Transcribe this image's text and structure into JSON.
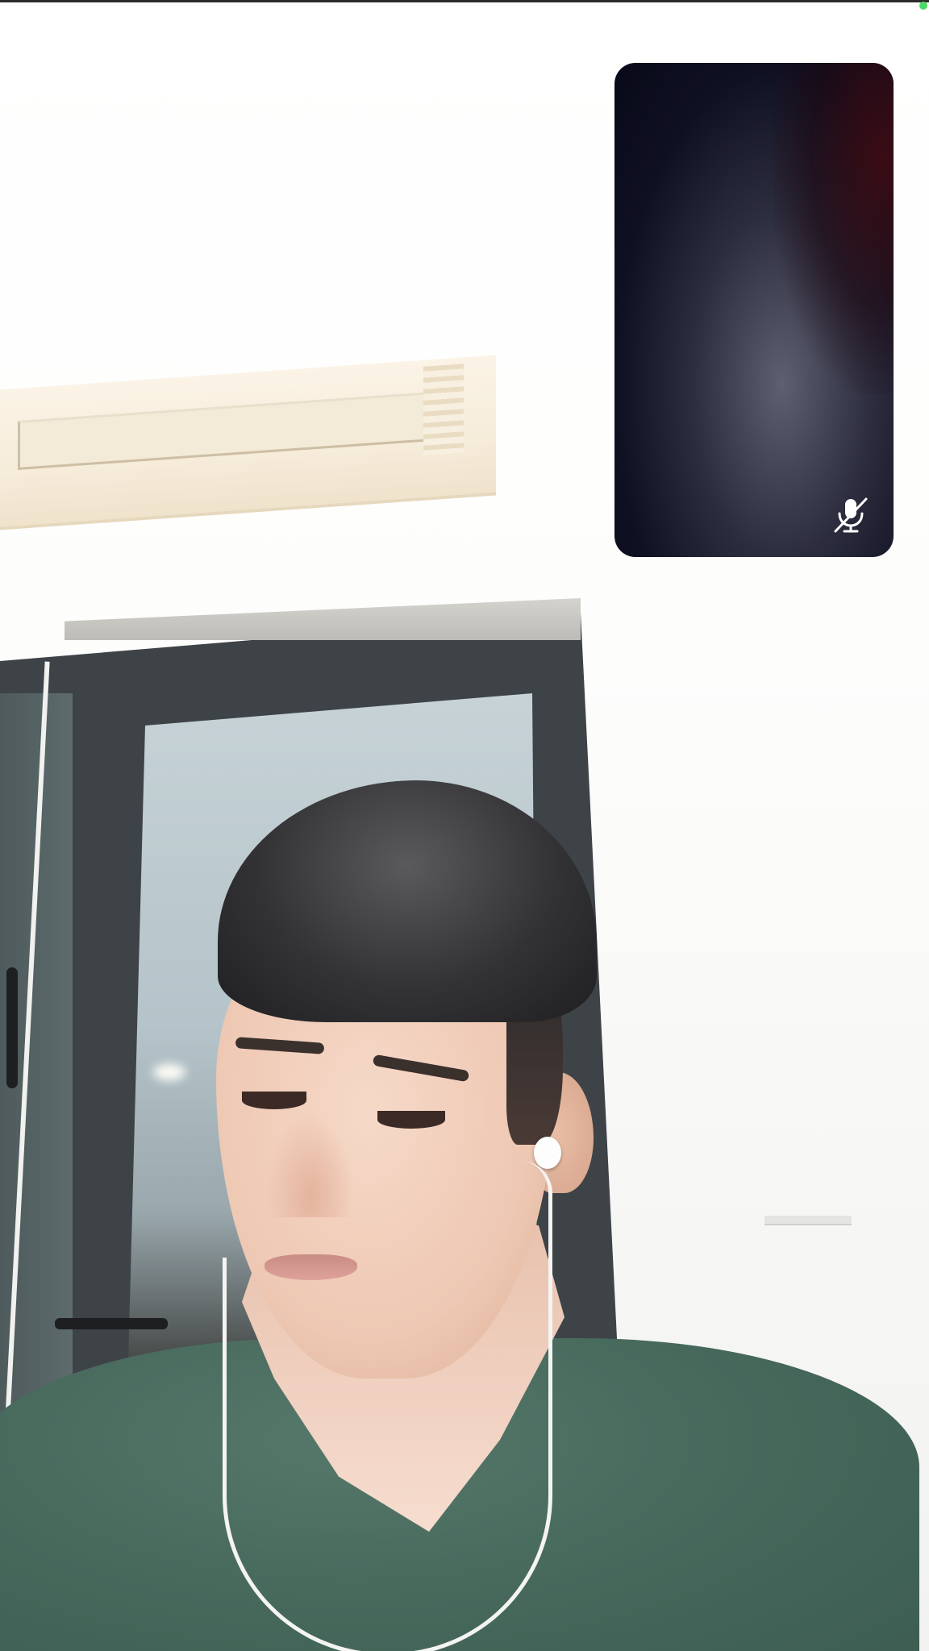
{
  "call": {
    "status": "connected",
    "remote_video": "remote-participant-video",
    "self_view": {
      "mic_state": "muted",
      "icon": "mic-muted-icon"
    },
    "indicator_color": "#4cd964"
  },
  "colors": {
    "pip_background": "#0f1022",
    "mute_icon": "#ffffff"
  }
}
